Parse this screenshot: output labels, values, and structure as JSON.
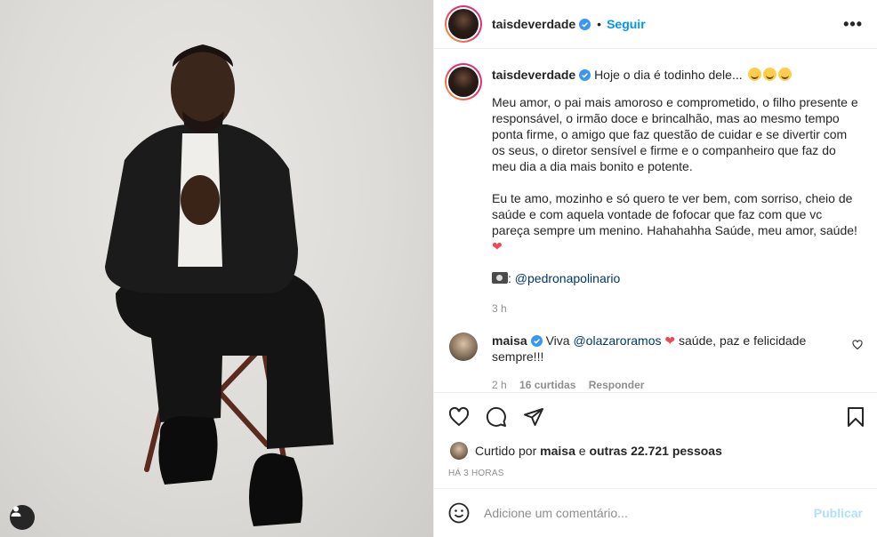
{
  "header": {
    "username": "taisdeverdade",
    "separator": "•",
    "follow_label": "Seguir",
    "more_label": "•••"
  },
  "caption": {
    "username": "taisdeverdade",
    "headline": "Hoje o dia é todinho dele...",
    "paragraph1": "Meu amor, o pai mais amoroso e comprometido, o filho presente e responsável, o irmão doce e brincalhão, mas ao mesmo tempo ponta firme, o amigo que faz questão de cuidar e se divertir com os seus, o diretor sensível e firme e o companheiro que faz do meu dia a dia mais bonito e potente.",
    "paragraph2": "Eu te amo, mozinho e só quero te ver bem, com sorriso, cheio de saúde e com aquela vontade de fofocar que faz com que vc pareça sempre um menino. Hahahahha Saúde, meu amor, saúde!",
    "heart": "❤",
    "credit_prefix": ":",
    "credit_handle": "@pedronapolinario",
    "time": "3 h"
  },
  "comment": {
    "username": "maisa",
    "prefix": "Viva",
    "mention": "@olazaroramos",
    "heart": "❤",
    "text": "saúde, paz e felicidade sempre!!!",
    "time": "2 h",
    "likes": "16 curtidas",
    "reply": "Responder"
  },
  "likes_line": {
    "prefix": "Curtido por",
    "user": "maisa",
    "connector": "e",
    "others": "outras 22.721 pessoas"
  },
  "posted_ago": "HÁ 3 HORAS",
  "add_comment": {
    "placeholder": "Adicione um comentário...",
    "publish": "Publicar"
  },
  "icons": {
    "verified": "verified-badge-icon",
    "like": "heart-icon",
    "comment": "comment-icon",
    "share": "share-icon",
    "save": "bookmark-icon",
    "emoji": "smiley-icon",
    "user_tag": "user-tag-icon"
  },
  "colors": {
    "accent": "#0095f6",
    "heart": "#ed4956",
    "muted": "#8e8e8e",
    "mention": "#00376b"
  }
}
